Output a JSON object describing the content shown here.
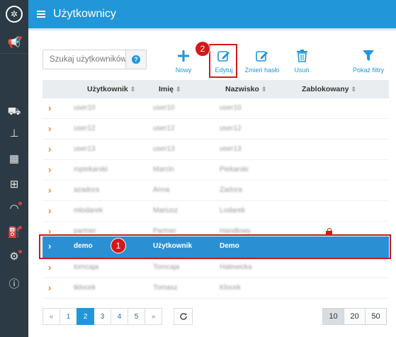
{
  "header": {
    "title": "Użytkownicy"
  },
  "search": {
    "placeholder": "Szukaj użytkowników",
    "help_icon": "?"
  },
  "toolbar": {
    "new_label": "Nowy",
    "edit_label": "Edytuj",
    "change_password_label": "Zmień hasło",
    "delete_label": "Usuń",
    "filters_label": "Pokaż filtry"
  },
  "annotations": {
    "edit_badge": "2",
    "row_badge": "1",
    "highlight_color": "#d21a1a"
  },
  "table": {
    "columns": [
      "Użytkownik",
      "Imię",
      "Nazwisko",
      "Zablokowany"
    ],
    "sort_glyph": "⇕",
    "rows": [
      {
        "username": "user10",
        "first_name": "user10",
        "last_name": "user10",
        "locked": false
      },
      {
        "username": "user12",
        "first_name": "user12",
        "last_name": "user12",
        "locked": false
      },
      {
        "username": "user13",
        "first_name": "user13",
        "last_name": "user13",
        "locked": false
      },
      {
        "username": "mpiekarski",
        "first_name": "Marcin",
        "last_name": "Piekarski",
        "locked": false
      },
      {
        "username": "azadora",
        "first_name": "Anna",
        "last_name": "Zadora",
        "locked": false
      },
      {
        "username": "mlodarek",
        "first_name": "Mariusz",
        "last_name": "Lodarek",
        "locked": false
      },
      {
        "username": "partner",
        "first_name": "Partner",
        "last_name": "Handlowy",
        "locked": true
      },
      {
        "username": "demo",
        "first_name": "Użytkownik",
        "last_name": "Demo",
        "locked": false,
        "selected": true
      },
      {
        "username": "tomcaja",
        "first_name": "Tomcaja",
        "last_name": "Halewicka",
        "locked": false
      },
      {
        "username": "tklocek",
        "first_name": "Tomasz",
        "last_name": "Klocek",
        "locked": false
      }
    ]
  },
  "pagination": {
    "pages": [
      "«",
      "1",
      "2",
      "3",
      "4",
      "5",
      "»"
    ],
    "current": "2"
  },
  "page_sizes": {
    "options": [
      "10",
      "20",
      "50"
    ],
    "selected": "10"
  },
  "colors": {
    "primary": "#2196d8",
    "sidebar": "#2b3a44",
    "chevron": "#ee7d1e",
    "selected_row": "#2b8fd4"
  }
}
